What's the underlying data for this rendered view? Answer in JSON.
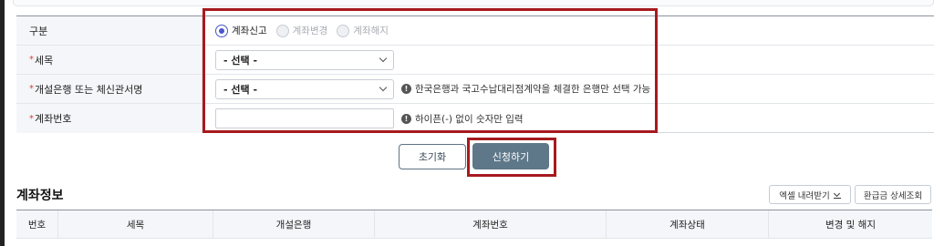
{
  "form": {
    "category": {
      "label": "구분",
      "options": [
        {
          "label": "계좌신고",
          "selected": true,
          "disabled": false
        },
        {
          "label": "계좌변경",
          "selected": false,
          "disabled": true
        },
        {
          "label": "계좌해지",
          "selected": false,
          "disabled": true
        }
      ]
    },
    "tax_item": {
      "required_mark": "*",
      "label": "세목",
      "value": "- 선택 -"
    },
    "bank": {
      "required_mark": "*",
      "label": "개설은행 또는 체신관서명",
      "value": "- 선택 -",
      "notice": "한국은행과 국고수납대리점계약을 체결한 은행만 선택 가능"
    },
    "account_number": {
      "required_mark": "*",
      "label": "계좌번호",
      "value": "",
      "notice": "하이픈(-) 없이 숫자만 입력"
    },
    "info_glyph": "!"
  },
  "actions": {
    "reset_label": "초기화",
    "apply_label": "신청하기"
  },
  "account_info": {
    "title": "계좌정보",
    "excel_button": "엑셀 내려받기",
    "refund_button": "환급금 상세조회",
    "columns": [
      "번호",
      "세목",
      "개설은행",
      "계좌번호",
      "계좌상태",
      "변경 및 해지"
    ]
  },
  "colors": {
    "highlight": "#a61a1e",
    "primary_button": "#5f7889",
    "radio_accent": "#4a56c8",
    "required": "#e53935"
  }
}
